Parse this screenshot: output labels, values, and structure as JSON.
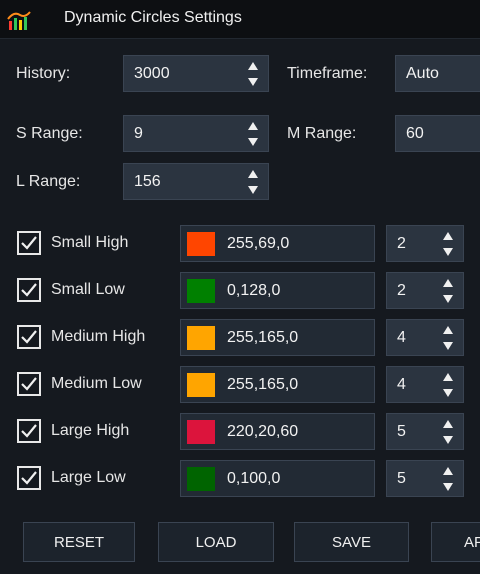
{
  "window": {
    "title": "Dynamic Circles Settings",
    "icon": "bar-chart-icon"
  },
  "settings": {
    "history_label": "History:",
    "history_value": "3000",
    "timeframe_label": "Timeframe:",
    "timeframe_value": "Auto",
    "s_range_label": "S Range:",
    "s_range_value": "9",
    "m_range_label": "M Range:",
    "m_range_value": "60",
    "l_range_label": "L Range:",
    "l_range_value": "156"
  },
  "circles": [
    {
      "label": "Small High",
      "checked": true,
      "color_text": "255,69,0",
      "color": "#ff4500",
      "width": "2"
    },
    {
      "label": "Small Low",
      "checked": true,
      "color_text": "0,128,0",
      "color": "#008000",
      "width": "2"
    },
    {
      "label": "Medium High",
      "checked": true,
      "color_text": "255,165,0",
      "color": "#ffa500",
      "width": "4"
    },
    {
      "label": "Medium Low",
      "checked": true,
      "color_text": "255,165,0",
      "color": "#ffa500",
      "width": "4"
    },
    {
      "label": "Large High",
      "checked": true,
      "color_text": "220,20,60",
      "color": "#dc143c",
      "width": "5"
    },
    {
      "label": "Large Low",
      "checked": true,
      "color_text": "0,100,0",
      "color": "#006400",
      "width": "5"
    }
  ],
  "buttons": {
    "reset": "RESET",
    "load": "LOAD",
    "save": "SAVE",
    "apply_partial": "AP"
  }
}
